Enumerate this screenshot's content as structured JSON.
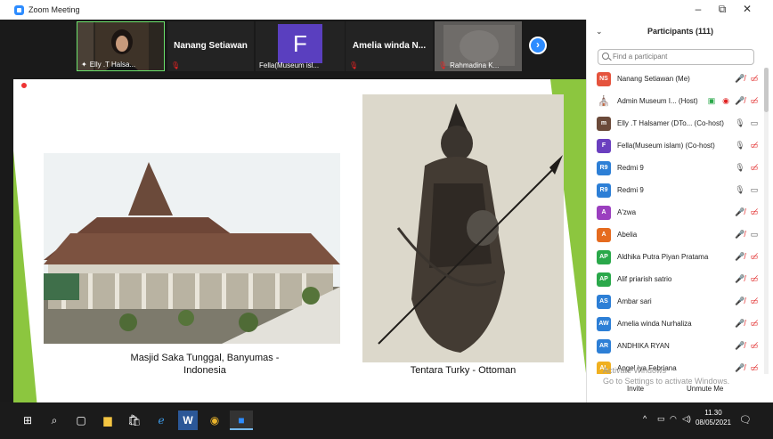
{
  "window": {
    "title": "Zoom Meeting",
    "minimize": "–",
    "maximize": "⧉",
    "close": "✕"
  },
  "video_strip": {
    "tiles": [
      {
        "label": "Elly .T Halsa...",
        "display_name": ""
      },
      {
        "label": "",
        "display_name": "Nanang Setiawan"
      },
      {
        "label": "Fella(Museum isl...",
        "display_name": "",
        "avatar_letter": "F"
      },
      {
        "label": "",
        "display_name": "Amelia winda N..."
      },
      {
        "label": "Rahmadina K...",
        "display_name": ""
      }
    ],
    "next_symbol": "›"
  },
  "slide": {
    "caption_left_line1": "Masjid Saka Tunggal, Banyumas -",
    "caption_left_line2": "Indonesia",
    "caption_right": "Tentara Turky - Ottoman",
    "accent_color": "#8cc63f"
  },
  "participants_panel": {
    "title": "Participants (111)",
    "search_placeholder": "Find a participant",
    "participants": [
      {
        "initials": "NS",
        "color": "#e5533d",
        "name": "Nanang Setiawan (Me)",
        "mic": "muted",
        "cam": "off"
      },
      {
        "initials": "",
        "color": "#4a9a3a",
        "name": "Admin Museum I... (Host)",
        "mic": "muted",
        "cam": "off",
        "image_avatar": true
      },
      {
        "initials": "m",
        "color": "#6b4a3a",
        "name": "Elly .T Halsamer (DTo...  (Co-host)",
        "mic": "on",
        "cam": "on"
      },
      {
        "initials": "F",
        "color": "#6a3fbf",
        "name": "Fella(Museum islam) (Co-host)",
        "mic": "on",
        "cam": "off"
      },
      {
        "initials": "R9",
        "color": "#2d7fd6",
        "name": "Redmi 9",
        "mic": "on",
        "cam": "off"
      },
      {
        "initials": "R9",
        "color": "#2d7fd6",
        "name": "Redmi 9",
        "mic": "on",
        "cam": "on"
      },
      {
        "initials": "A",
        "color": "#9b3fbf",
        "name": "A'zwa",
        "mic": "muted",
        "cam": "off"
      },
      {
        "initials": "A",
        "color": "#e56b1f",
        "name": "Abelia",
        "mic": "muted",
        "cam": "on"
      },
      {
        "initials": "AP",
        "color": "#2aa84a",
        "name": "Aldhika Putra Piyan Pratama",
        "mic": "muted",
        "cam": "off"
      },
      {
        "initials": "AP",
        "color": "#2aa84a",
        "name": "Alif priarish satrio",
        "mic": "muted",
        "cam": "off"
      },
      {
        "initials": "AS",
        "color": "#2d7fd6",
        "name": "Ambar sari",
        "mic": "muted",
        "cam": "off"
      },
      {
        "initials": "AW",
        "color": "#2d7fd6",
        "name": "Amelia winda Nurhaliza",
        "mic": "muted",
        "cam": "off"
      },
      {
        "initials": "AR",
        "color": "#2d7fd6",
        "name": "ANDHIKA RYAN",
        "mic": "muted",
        "cam": "off"
      },
      {
        "initials": "AL",
        "color": "#f0b020",
        "name": "Angel iya Febriana",
        "mic": "muted",
        "cam": "off"
      }
    ],
    "watermark_line1": "Activate Windows",
    "watermark_line2": "Go to Settings to activate Windows.",
    "invite_label": "Invite",
    "unmute_label": "Unmute Me"
  },
  "taskbar": {
    "time": "11.30",
    "date": "08/05/2021"
  }
}
